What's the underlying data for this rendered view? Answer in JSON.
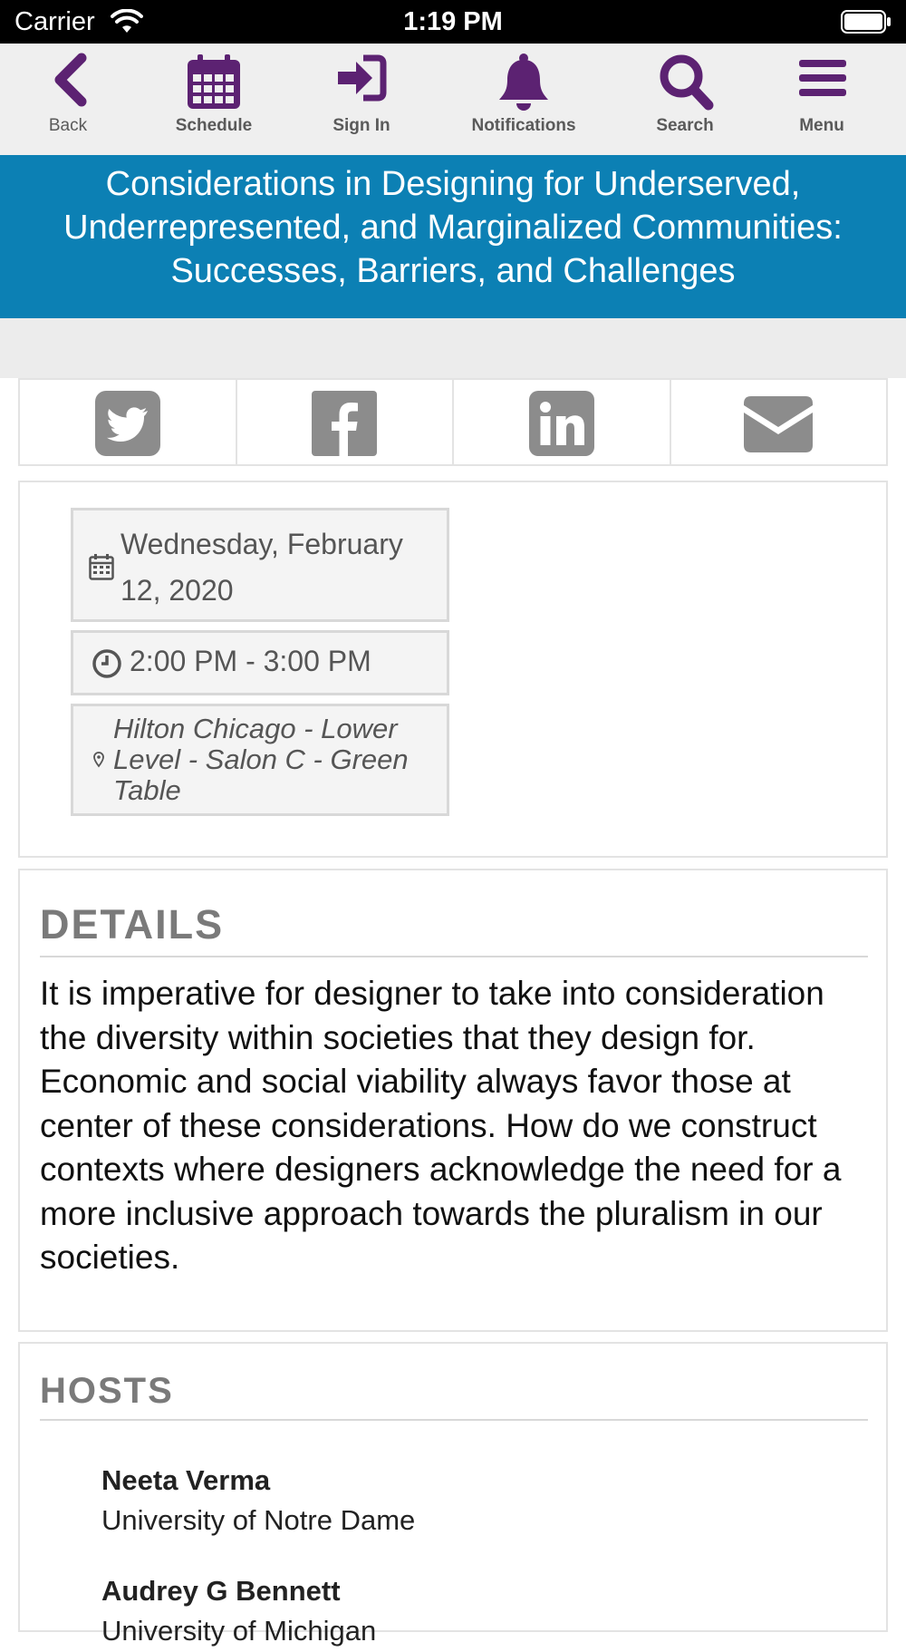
{
  "status_bar": {
    "carrier": "Carrier",
    "time": "1:19 PM",
    "icons": [
      "wifi-icon",
      "battery-icon"
    ]
  },
  "toolbar": {
    "accent_color": "#5c2272",
    "items": [
      {
        "label": "Back",
        "icon": "chevron-left-icon"
      },
      {
        "label": "Schedule",
        "icon": "calendar-icon"
      },
      {
        "label": "Sign In",
        "icon": "sign-in-icon"
      },
      {
        "label": "Notifications",
        "icon": "bell-icon"
      },
      {
        "label": "Search",
        "icon": "search-icon"
      },
      {
        "label": "Menu",
        "icon": "menu-icon"
      }
    ]
  },
  "session": {
    "title": "Considerations in Designing for Underserved, Underrepresented, and Marginalized Communities: Successes, Barriers, and Challenges",
    "banner_color": "#0c80b4"
  },
  "share": {
    "icons": [
      "twitter-icon",
      "facebook-icon",
      "linkedin-icon",
      "email-icon"
    ],
    "icon_color": "#8c8c8c"
  },
  "info": {
    "date": "Wednesday, February 12, 2020",
    "time": "2:00 PM - 3:00 PM",
    "location": "Hilton Chicago - Lower Level - Salon C - Green Table"
  },
  "details": {
    "heading": "DETAILS",
    "body": "It is imperative for designer to take into consideration the diversity within societies that they design for. Economic and social viability always favor those at center of these considerations. How do we construct contexts where designers acknowledge the need for a more inclusive approach towards the pluralism in our societies."
  },
  "hosts": {
    "heading": "HOSTS",
    "people": [
      {
        "name": "Neeta Verma",
        "org": "University of Notre Dame"
      },
      {
        "name": "Audrey G Bennett",
        "org": "University of Michigan"
      }
    ]
  }
}
